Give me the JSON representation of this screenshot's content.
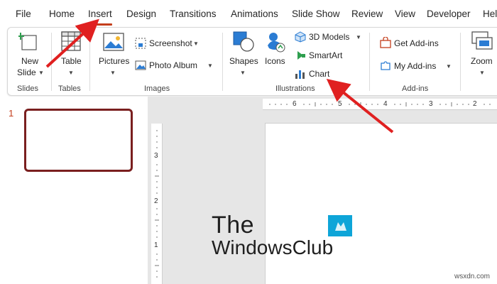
{
  "tabs": [
    {
      "label": "File"
    },
    {
      "label": "Home"
    },
    {
      "label": "Insert"
    },
    {
      "label": "Design"
    },
    {
      "label": "Transitions"
    },
    {
      "label": "Animations"
    },
    {
      "label": "Slide Show"
    },
    {
      "label": "Review"
    },
    {
      "label": "View"
    },
    {
      "label": "Developer"
    },
    {
      "label": "Hel"
    }
  ],
  "active_tab": "Insert",
  "ribbon": {
    "slides": {
      "new_slide_line1": "New",
      "new_slide_line2": "Slide",
      "group_label": "Slides"
    },
    "tables": {
      "table": "Table",
      "group_label": "Tables"
    },
    "images": {
      "pictures": "Pictures",
      "screenshot": "Screenshot",
      "photo_album": "Photo Album",
      "group_label": "Images"
    },
    "illustrations": {
      "shapes": "Shapes",
      "icons": "Icons",
      "models3d": "3D Models",
      "smartart": "SmartArt",
      "chart": "Chart",
      "group_label": "Illustrations"
    },
    "addins": {
      "get_addins": "Get Add-ins",
      "my_addins": "My Add-ins",
      "group_label": "Add-ins"
    },
    "zoom": {
      "zoom_line1": "Zoom",
      "zoom_line2": "~"
    }
  },
  "slide_panel": {
    "slide_number": "1"
  },
  "rulers": {
    "h": [
      "6",
      "5",
      "4",
      "3",
      "2"
    ],
    "v": [
      "3",
      "2",
      "1"
    ]
  },
  "watermark": {
    "line1": "The",
    "line2": "WindowsClub"
  },
  "footer": {
    "url": "wsxdn.com"
  },
  "colors": {
    "accent": "#c43e1c",
    "arrow": "#e02020",
    "thumb_border": "#7a1f1f"
  }
}
